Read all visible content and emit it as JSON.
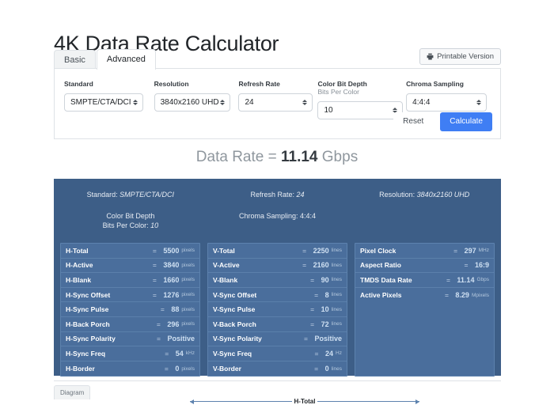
{
  "header": {
    "title": "4K Data Rate Calculator",
    "printable_label": "Printable Version",
    "printer_icon": "printer-icon"
  },
  "tabs": [
    {
      "label": "Basic",
      "active": false
    },
    {
      "label": "Advanced",
      "active": true
    }
  ],
  "form": {
    "fields": [
      {
        "label": "Standard",
        "sublabel": "",
        "value": "SMPTE/CTA/DCI"
      },
      {
        "label": "Resolution",
        "sublabel": "",
        "value": "3840x2160 UHD"
      },
      {
        "label": "Refresh Rate",
        "sublabel": "",
        "value": "24"
      },
      {
        "label": "Color Bit Depth",
        "sublabel": "Bits Per Color",
        "value": "10"
      },
      {
        "label": "Chroma Sampling",
        "sublabel": "",
        "value": "4:4:4"
      }
    ],
    "reset_label": "Reset",
    "calculate_label": "Calculate"
  },
  "result": {
    "prefix": "Data Rate = ",
    "value": "11.14",
    "unit": " Gbps"
  },
  "panel": {
    "accent_bg": "#3d5e87",
    "table_bg": "#4a6e9c",
    "summary_top": [
      {
        "label": "Standard: ",
        "value": "SMPTE/CTA/DCI"
      },
      {
        "label": "Refresh Rate: ",
        "value": "24"
      },
      {
        "label": "Resolution: ",
        "value": "3840x2160 UHD"
      }
    ],
    "summary_bottom": [
      {
        "label": "Color Bit Depth",
        "label2": "Bits Per Color: ",
        "value": "10"
      },
      {
        "label": "Chroma Sampling: ",
        "value": "4:4:4"
      },
      {
        "label": "",
        "value": ""
      }
    ],
    "columns": [
      {
        "name": "horizontal",
        "rows": [
          {
            "key": "H-Total",
            "eq": "=",
            "value": "5500",
            "unit": "pixels"
          },
          {
            "key": "H-Active",
            "eq": "=",
            "value": "3840",
            "unit": "pixels"
          },
          {
            "key": "H-Blank",
            "eq": "=",
            "value": "1660",
            "unit": "pixels"
          },
          {
            "key": "H-Sync Offset",
            "eq": "=",
            "value": "1276",
            "unit": "pixels"
          },
          {
            "key": "H-Sync Pulse",
            "eq": "=",
            "value": "88",
            "unit": "pixels"
          },
          {
            "key": "H-Back Porch",
            "eq": "=",
            "value": "296",
            "unit": "pixels"
          },
          {
            "key": "H-Sync Polarity",
            "eq": "=",
            "value": "Positive",
            "unit": ""
          },
          {
            "key": "H-Sync Freq",
            "eq": "=",
            "value": "54",
            "unit": "kHz"
          },
          {
            "key": "H-Border",
            "eq": "=",
            "value": "0",
            "unit": "pixels"
          }
        ]
      },
      {
        "name": "vertical",
        "rows": [
          {
            "key": "V-Total",
            "eq": "=",
            "value": "2250",
            "unit": "lines"
          },
          {
            "key": "V-Active",
            "eq": "=",
            "value": "2160",
            "unit": "lines"
          },
          {
            "key": "V-Blank",
            "eq": "=",
            "value": "90",
            "unit": "lines"
          },
          {
            "key": "V-Sync Offset",
            "eq": "=",
            "value": "8",
            "unit": "lines"
          },
          {
            "key": "V-Sync Pulse",
            "eq": "=",
            "value": "10",
            "unit": "lines"
          },
          {
            "key": "V-Back Porch",
            "eq": "=",
            "value": "72",
            "unit": "lines"
          },
          {
            "key": "V-Sync Polarity",
            "eq": "=",
            "value": "Positive",
            "unit": ""
          },
          {
            "key": "V-Sync Freq",
            "eq": "=",
            "value": "24",
            "unit": "Hz"
          },
          {
            "key": "V-Border",
            "eq": "=",
            "value": "0",
            "unit": "lines"
          }
        ]
      },
      {
        "name": "summary",
        "rows": [
          {
            "key": "Pixel Clock",
            "eq": "=",
            "value": "297",
            "unit": "MHz"
          },
          {
            "key": "Aspect Ratio",
            "eq": "=",
            "value": "16:9",
            "unit": ""
          },
          {
            "key": "TMDS Data Rate",
            "eq": "=",
            "value": "11.14",
            "unit": "Gbps"
          },
          {
            "key": "Active Pixels",
            "eq": "=",
            "value": "8.29",
            "unit": "Mpixels"
          }
        ]
      }
    ]
  },
  "diagram": {
    "tab_label": "Diagram",
    "htotal_label": "H-Total"
  }
}
